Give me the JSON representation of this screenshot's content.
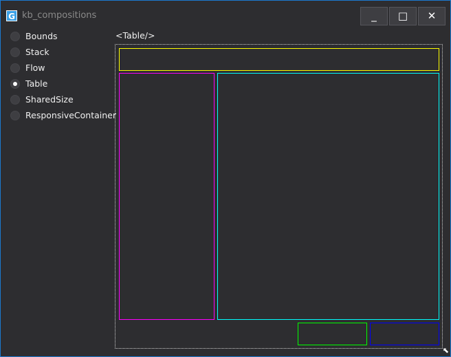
{
  "window": {
    "title": "kb_compositions",
    "app_icon": "G",
    "minimize": "_",
    "maximize": "□",
    "close": "✕"
  },
  "sidebar": {
    "items": [
      {
        "label": "Bounds",
        "selected": false
      },
      {
        "label": "Stack",
        "selected": false
      },
      {
        "label": "Flow",
        "selected": false
      },
      {
        "label": "Table",
        "selected": true
      },
      {
        "label": "SharedSize",
        "selected": false
      },
      {
        "label": "ResponsiveContainer",
        "selected": false
      }
    ]
  },
  "main": {
    "heading": "<Table/>"
  },
  "colors": {
    "header": "#ffff00",
    "left": "#ff00ff",
    "content": "#00ffff",
    "ok": "#00ff00",
    "cancel": "#0000ff"
  }
}
